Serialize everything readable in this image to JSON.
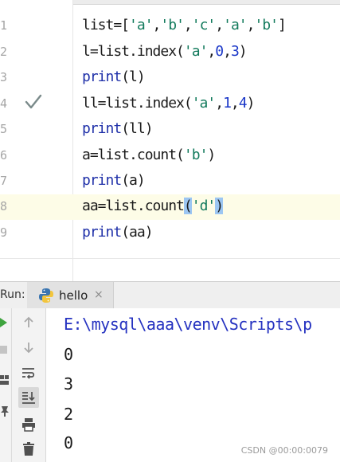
{
  "editor": {
    "tab_hint": "py",
    "lines": [
      {
        "num": "1"
      },
      {
        "num": "2"
      },
      {
        "num": "3"
      },
      {
        "num": "4"
      },
      {
        "num": "5"
      },
      {
        "num": "6"
      },
      {
        "num": "7"
      },
      {
        "num": "8"
      },
      {
        "num": "9"
      }
    ],
    "code": {
      "l1": {
        "a": "list=[",
        "s1": "'a'",
        "c1": ",",
        "s2": "'b'",
        "c2": ",",
        "s3": "'c'",
        "c3": ",",
        "s4": "'a'",
        "c4": ",",
        "s5": "'b'",
        "end": "]"
      },
      "l2": {
        "a": "l=list.index(",
        "s": "'a'",
        "b": ",",
        "n1": "0",
        "c": ",",
        "n2": "3",
        "end": ")"
      },
      "l3": {
        "f": "print",
        "rest": "(l)"
      },
      "l4": {
        "a": "ll=list.index(",
        "s": "'a'",
        "b": ",",
        "n1": "1",
        "c": ",",
        "n2": "4",
        "end": ")"
      },
      "l5": {
        "f": "print",
        "rest": "(ll)"
      },
      "l6": {
        "a": "a=list.count(",
        "s": "'b'",
        "end": ")"
      },
      "l7": {
        "f": "print",
        "rest": "(a)"
      },
      "l8": {
        "a": "aa=list.count",
        "p1": "(",
        "s": "'d'",
        "p2": ")"
      },
      "l9": {
        "f": "print",
        "rest": "(aa)"
      }
    },
    "gutter_icon": "checkmark-icon"
  },
  "run": {
    "label": "Run:",
    "tab_label": "hello",
    "tab_icon": "python-icon",
    "close_glyph": "×",
    "toolbar_icons": [
      "rerun-icon",
      "stop-icon",
      "layout-icon",
      "pin-icon",
      "scroll-up-icon",
      "scroll-down-icon",
      "soft-wrap-icon",
      "scroll-to-end-icon",
      "print-icon",
      "trash-icon"
    ],
    "output": [
      "E:\\mysql\\aaa\\venv\\Scripts\\p",
      "0",
      "3",
      "2",
      "0"
    ]
  },
  "watermark": "CSDN @00:00:0079",
  "colors": {
    "string": "#127a5c",
    "number": "#1a37c8",
    "builtin": "#1e2fa8",
    "highlight_line": "#fdfce7",
    "brace_match": "#9cc6f2",
    "console_path": "#2431c0"
  }
}
